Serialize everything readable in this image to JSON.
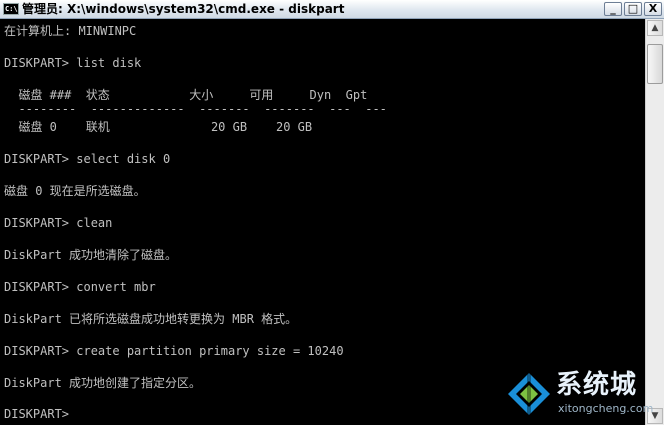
{
  "window": {
    "title": "管理员: X:\\windows\\system32\\cmd.exe - diskpart",
    "minimize": "_",
    "maximize": "□",
    "close": "X"
  },
  "console": {
    "lines": [
      "在计算机上: MINWINPC",
      "DISKPART> list disk",
      "  磁盘 ###  状态           大小     可用     Dyn  Gpt",
      "  --------  -------------  -------  -------  ---  ---",
      "  磁盘 0    联机              20 GB    20 GB",
      "DISKPART> select disk 0",
      "磁盘 0 现在是所选磁盘。",
      "DISKPART> clean",
      "DiskPart 成功地清除了磁盘。",
      "DISKPART> convert mbr",
      "DiskPart 已将所选磁盘成功地转更换为 MBR 格式。",
      "DISKPART> create partition primary size = 10240",
      "DiskPart 成功地创建了指定分区。",
      "DISKPART>"
    ]
  },
  "scrollbar": {
    "up": "▲",
    "down": "▼"
  },
  "watermark": {
    "brand": "系统城",
    "url": "xitongcheng.com"
  },
  "colors": {
    "console_bg": "#000000",
    "console_text": "#c0c0c0",
    "logo_blue": "#1a8fd8",
    "logo_green": "#7dc242"
  }
}
